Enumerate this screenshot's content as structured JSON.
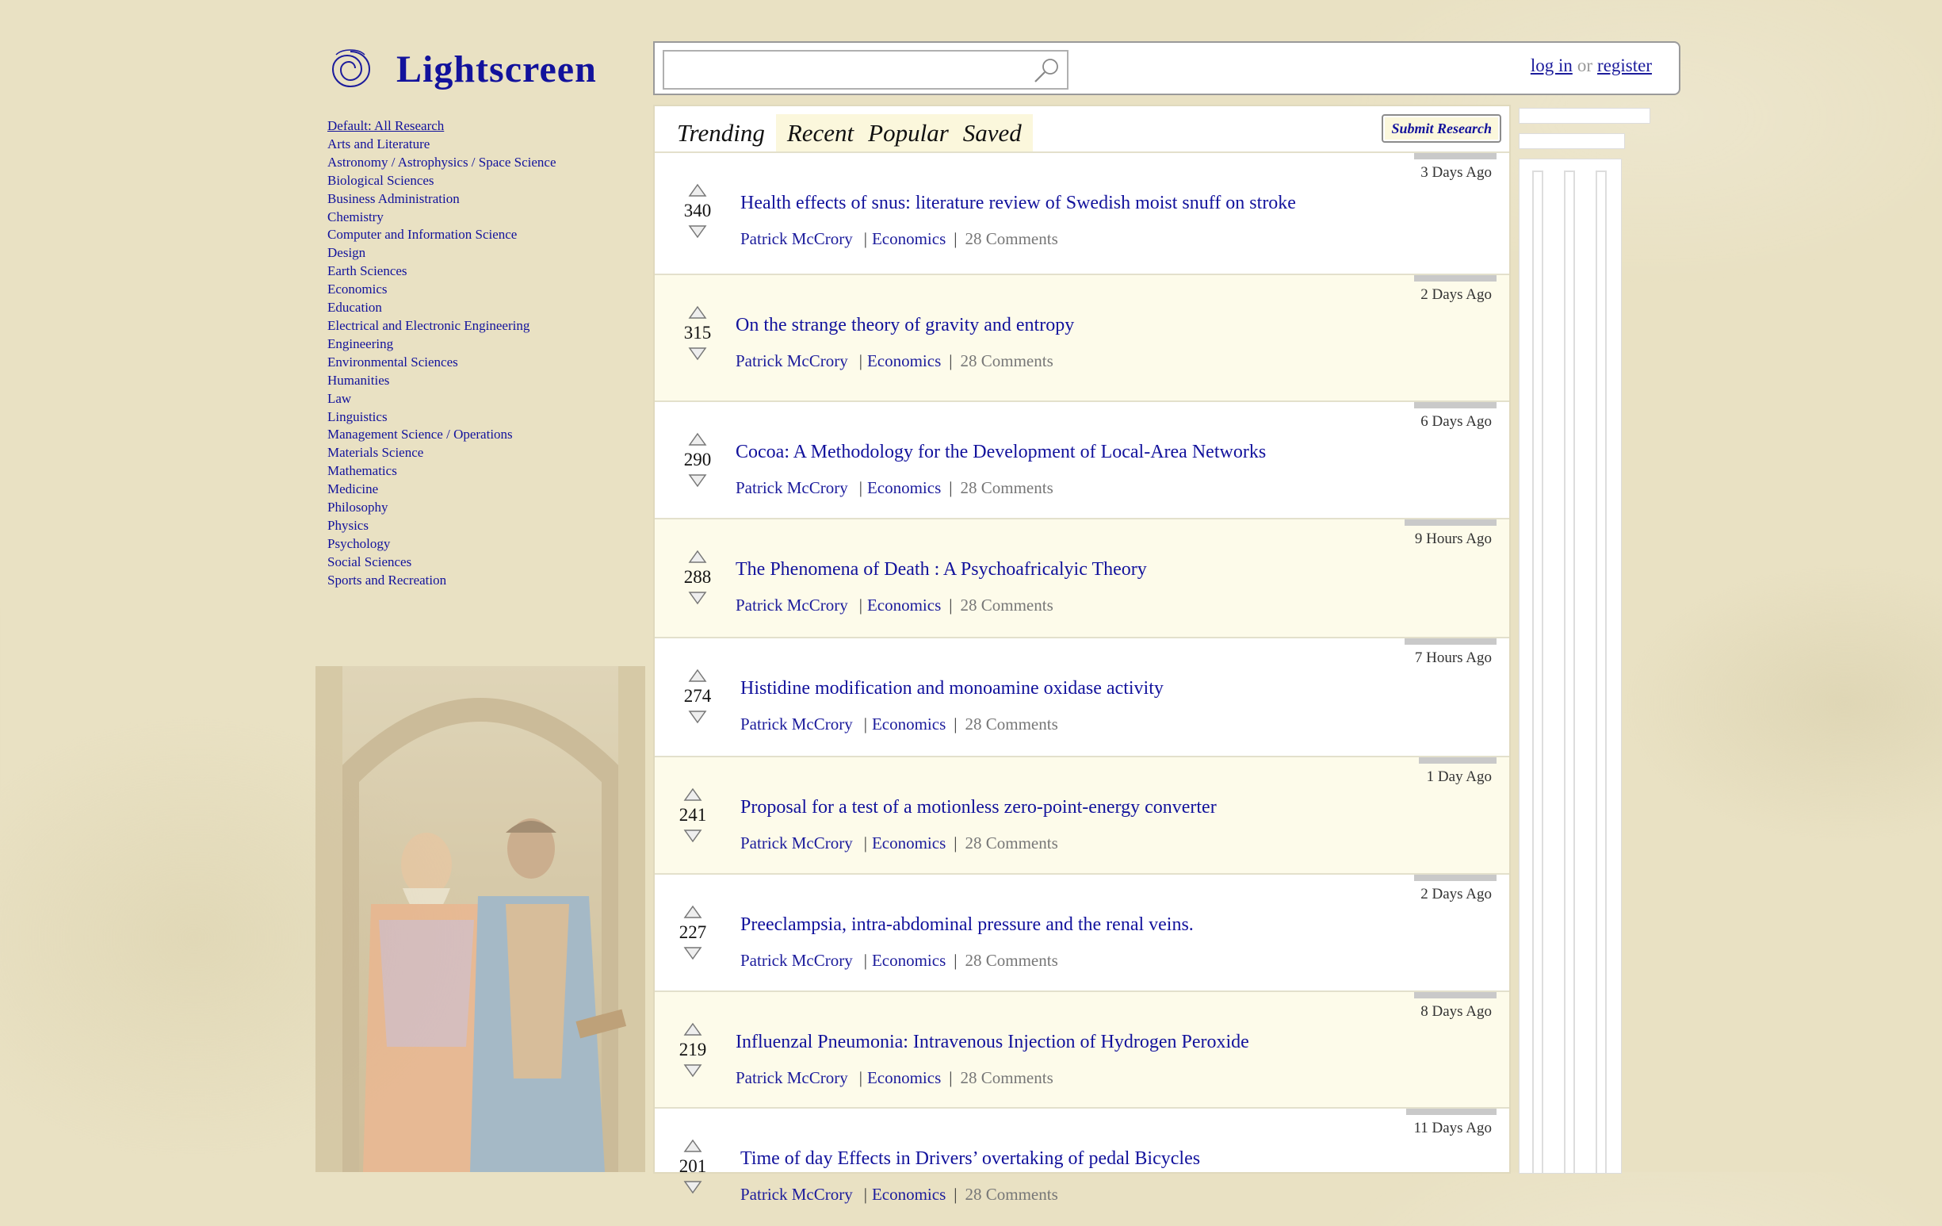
{
  "brand": {
    "title": "Lightscreen"
  },
  "categories": [
    "Default: All Research",
    "Arts and Literature",
    "Astronomy / Astrophysics / Space Science",
    "Biological Sciences",
    "Business Administration",
    "Chemistry",
    "Computer and Information Science",
    "Design",
    "Earth Sciences",
    "Economics",
    "Education",
    "Electrical and Electronic Engineering",
    "Engineering",
    "Environmental Sciences",
    "Humanities",
    "Law",
    "Linguistics",
    "Management Science / Operations",
    "Materials Science",
    "Mathematics",
    "Medicine",
    "Philosophy",
    "Physics",
    "Psychology",
    "Social Sciences",
    "Sports and Recreation"
  ],
  "search": {
    "value": "",
    "placeholder": ""
  },
  "auth": {
    "login": "log in",
    "or": "or",
    "register": "register"
  },
  "tabs": [
    "Trending",
    "Recent",
    "Popular",
    "Saved"
  ],
  "active_tab": "Trending",
  "submit_label": "Submit Research",
  "posts": [
    {
      "votes": "340",
      "title": "Health effects of snus: literature review of Swedish moist snuff on stroke",
      "author": "Patrick McCrory",
      "category": "Economics",
      "comments": "28 Comments",
      "time": "3 Days Ago"
    },
    {
      "votes": "315",
      "title": "On the strange theory of gravity and entropy",
      "author": "Patrick McCrory",
      "category": "Economics",
      "comments": "28 Comments",
      "time": "2 Days Ago"
    },
    {
      "votes": "290",
      "title": "Cocoa: A Methodology for the Development of Local-Area Networks",
      "author": "Patrick McCrory",
      "category": "Economics",
      "comments": "28 Comments",
      "time": "6 Days Ago"
    },
    {
      "votes": "288",
      "title": "The Phenomena of Death : A Psychoafricalyic Theory",
      "author": "Patrick McCrory",
      "category": "Economics",
      "comments": "28 Comments",
      "time": "9 Hours Ago"
    },
    {
      "votes": "274",
      "title": "Histidine modification and monoamine oxidase activity",
      "author": "Patrick McCrory",
      "category": "Economics",
      "comments": "28 Comments",
      "time": "7 Hours Ago"
    },
    {
      "votes": "241",
      "title": "Proposal for a test of a motionless zero-point-energy converter",
      "author": "Patrick McCrory",
      "category": "Economics",
      "comments": "28 Comments",
      "time": "1 Day Ago"
    },
    {
      "votes": "227",
      "title": "Preeclampsia, intra-abdominal pressure and the renal veins.",
      "author": "Patrick McCrory",
      "category": "Economics",
      "comments": "28 Comments",
      "time": "2 Days Ago"
    },
    {
      "votes": "219",
      "title": "Influenzal Pneumonia: Intravenous Injection of Hydrogen Peroxide",
      "author": "Patrick McCrory",
      "category": "Economics",
      "comments": "28 Comments",
      "time": "8 Days Ago"
    },
    {
      "votes": "201",
      "title": "Time of day Effects in Drivers’ overtaking of pedal Bicycles",
      "author": "Patrick McCrory",
      "category": "Economics",
      "comments": "28 Comments",
      "time": "11 Days Ago"
    }
  ]
}
